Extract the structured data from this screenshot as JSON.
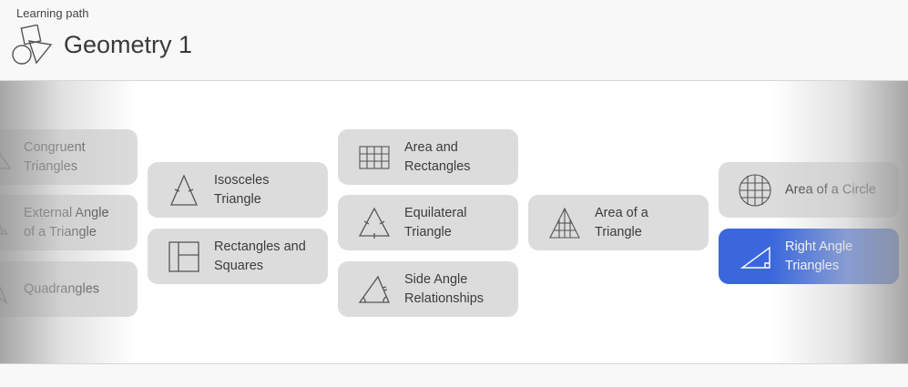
{
  "header": {
    "kicker": "Learning path",
    "title": "Geometry 1",
    "logo_icon": "geometry-shapes-icon"
  },
  "colors": {
    "card_bg": "#dcdcdc",
    "selected_bg": "#3a68dc",
    "page_bg": "#f8f8f8"
  },
  "lessons": [
    {
      "label": "Congruent\nTriangles",
      "icon": "congruent-triangles-icon",
      "selected": false
    },
    {
      "label": "External Angle\nof a Triangle",
      "icon": "external-angle-icon",
      "selected": false
    },
    {
      "label": "Quadrangles",
      "icon": "quadrangle-icon",
      "selected": false
    },
    {
      "label": "Isosceles\nTriangle",
      "icon": "isosceles-triangle-icon",
      "selected": false
    },
    {
      "label": "Rectangles and\nSquares",
      "icon": "rectangles-squares-icon",
      "selected": false
    },
    {
      "label": "Area and\nRectangles",
      "icon": "grid-rectangle-icon",
      "selected": false
    },
    {
      "label": "Equilateral\nTriangle",
      "icon": "equilateral-triangle-icon",
      "selected": false
    },
    {
      "label": "Side Angle\nRelationships",
      "icon": "side-angle-icon",
      "selected": false
    },
    {
      "label": "Area of a\nTriangle",
      "icon": "triangle-area-icon",
      "selected": false
    },
    {
      "label": "Area of a Circle",
      "icon": "circle-area-icon",
      "selected": false
    },
    {
      "label": "Right Angle\nTriangles",
      "icon": "right-triangle-icon",
      "selected": true
    }
  ]
}
